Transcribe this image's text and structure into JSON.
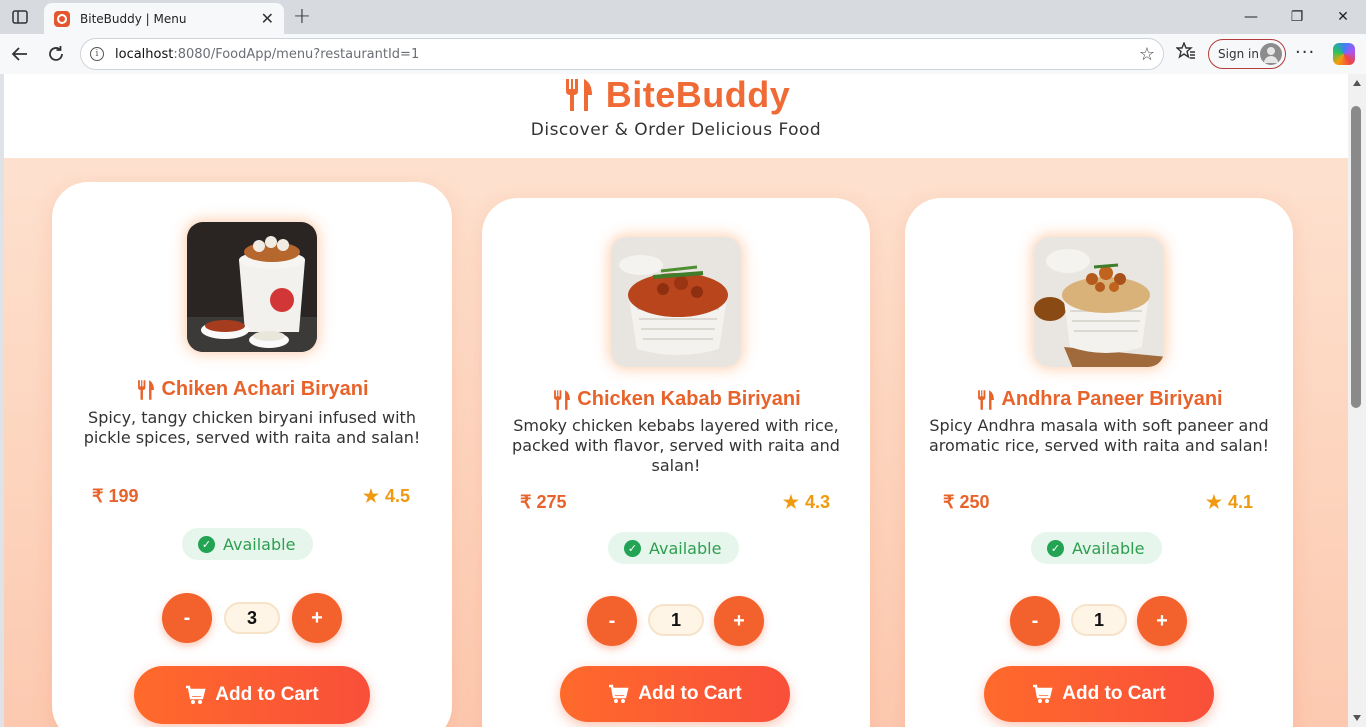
{
  "browser": {
    "tab_title": "BiteBuddy | Menu",
    "tab_close": "✕",
    "new_tab": "+",
    "url_host": "localhost",
    "url_path": ":8080/FoodApp/menu?restaurantId=1",
    "signin_label": "Sign in",
    "window_controls": [
      "—",
      "❐",
      "✕"
    ]
  },
  "header": {
    "brand": "BiteBuddy",
    "tagline": "Discover & Order Delicious Food",
    "brand_color": "#f06a35"
  },
  "items": [
    {
      "name": "Chiken Achari Biryani",
      "description": "Spicy, tangy chicken biryani infused with pickle spices, served with raita and salan!",
      "price": "₹ 199",
      "rating": "4.5",
      "status": "Available",
      "quantity": "3",
      "minus_label": "-",
      "plus_label": "+",
      "cart_label": "Add to Cart"
    },
    {
      "name": "Chicken Kabab Biriyani",
      "description": "Smoky chicken kebabs layered with rice, packed with flavor, served with raita and salan!",
      "price": "₹ 275",
      "rating": "4.3",
      "status": "Available",
      "quantity": "1",
      "minus_label": "-",
      "plus_label": "+",
      "cart_label": "Add to Cart"
    },
    {
      "name": "Andhra Paneer Biriyani",
      "description": "Spicy Andhra masala with soft paneer and aromatic rice, served with raita and salan!",
      "price": "₹ 250",
      "rating": "4.1",
      "status": "Available",
      "quantity": "1",
      "minus_label": "-",
      "plus_label": "+",
      "cart_label": "Add to Cart"
    }
  ],
  "colors": {
    "accent": "#f3622c",
    "rating": "#ef9a10",
    "available": "#2e9e4f"
  }
}
